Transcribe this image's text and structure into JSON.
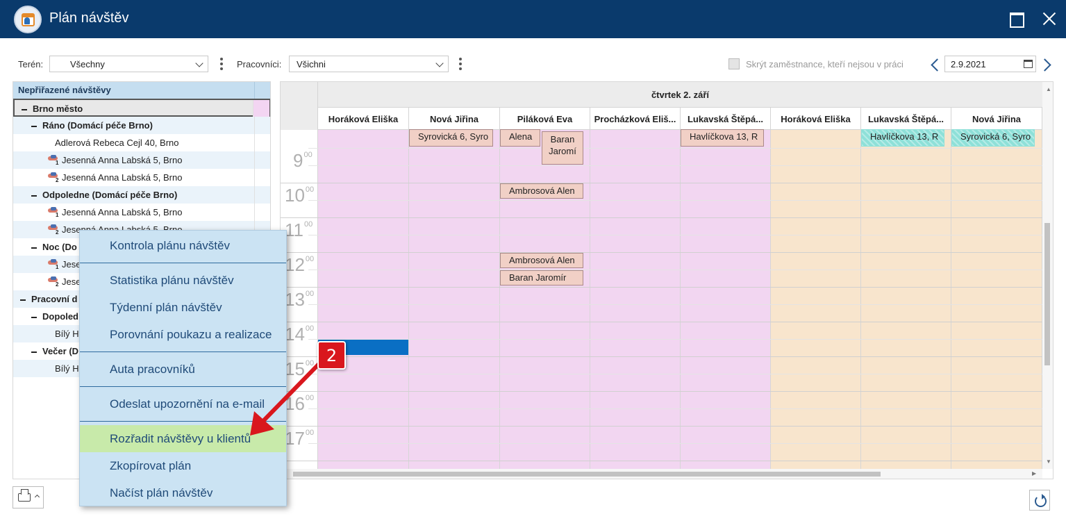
{
  "window": {
    "title": "Plán návštěv"
  },
  "filters": {
    "teren_label": "Terén:",
    "teren_value": "Všechny",
    "pracovnici_label": "Pracovníci:",
    "pracovnici_value": "Všichni",
    "hide_label": "Skrýt zaměstnance, kteří nejsou v práci",
    "date": "2.9.2021"
  },
  "tree": {
    "header": "Nepřiřazené návštěvy",
    "rows": [
      {
        "label": "Brno město",
        "level": 0,
        "type": "group"
      },
      {
        "label": "Ráno (Domácí péče Brno)",
        "level": 1,
        "type": "group"
      },
      {
        "label": "Adlerová Rebeca Cejl 40, Brno",
        "level": 2,
        "type": "item"
      },
      {
        "label": "Jesenná Anna Labská 5, Brno",
        "level": 2,
        "type": "visit",
        "badge": "1"
      },
      {
        "label": "Jesenná Anna Labská 5, Brno",
        "level": 2,
        "type": "visit",
        "badge": "2"
      },
      {
        "label": "Odpoledne (Domácí péče Brno)",
        "level": 1,
        "type": "group"
      },
      {
        "label": "Jesenná Anna Labská 5, Brno",
        "level": 2,
        "type": "visit",
        "badge": "1"
      },
      {
        "label": "Jesenná Anna Labská 5, Brno",
        "level": 2,
        "type": "visit",
        "badge": "2"
      },
      {
        "label": "Noc (Do",
        "level": 1,
        "type": "group"
      },
      {
        "label": "Jese",
        "level": 2,
        "type": "visit",
        "badge": "1"
      },
      {
        "label": "Jese",
        "level": 2,
        "type": "visit",
        "badge": "2"
      },
      {
        "label": "Pracovní d",
        "level": 0,
        "type": "group"
      },
      {
        "label": "Dopoled",
        "level": 1,
        "type": "group"
      },
      {
        "label": "Bílý H",
        "level": 2,
        "type": "item"
      },
      {
        "label": "Večer (D",
        "level": 1,
        "type": "group"
      },
      {
        "label": "Bílý H",
        "level": 2,
        "type": "item"
      }
    ]
  },
  "calendar": {
    "day_title": "čtvrtek 2. září",
    "columns": [
      "Horáková Eliška",
      "Nová Jiřina",
      "Piláková Eva",
      "Procházková Eliš...",
      "Lukavská Štěpá...",
      "Horáková Eliška",
      "Lukavská Štěpá...",
      "Nová Jiřina"
    ],
    "hours": [
      "9",
      "10",
      "11",
      "12",
      "13",
      "14",
      "15",
      "16",
      "17"
    ],
    "minutes": "00",
    "events": [
      {
        "text": "Syrovická 6, Syro"
      },
      {
        "text": "Alena"
      },
      {
        "text": "Baran Jaromí"
      },
      {
        "text": "Havlíčkova 13, R"
      },
      {
        "text": "Havlíčkova 13, R"
      },
      {
        "text": "Syrovická 6, Syro"
      },
      {
        "text": "Ambrosová Alen"
      },
      {
        "text": "Ambrosová Alen"
      },
      {
        "text": "Baran Jaromír"
      }
    ]
  },
  "context_menu": {
    "items": [
      "Kontrola plánu návštěv",
      "Statistika plánu návštěv",
      "Týdenní plán návštěv",
      "Porovnání poukazu a realizace",
      "Auta pracovníků",
      "Odeslat upozornění na e-mail",
      "Rozřadit návštěvy u klientů",
      "Zkopírovat plán",
      "Načíst plán návštěv"
    ],
    "highlighted_index": 6
  },
  "annotation": {
    "number": "2",
    "color": "#d9171d"
  },
  "colors": {
    "titlebar": "#0a3a6c",
    "menu_bg": "#cbe3f3",
    "menu_highlight": "#c8eaaa",
    "pink_column": "#f2d6f1",
    "peach_column": "#f8e5cd"
  }
}
